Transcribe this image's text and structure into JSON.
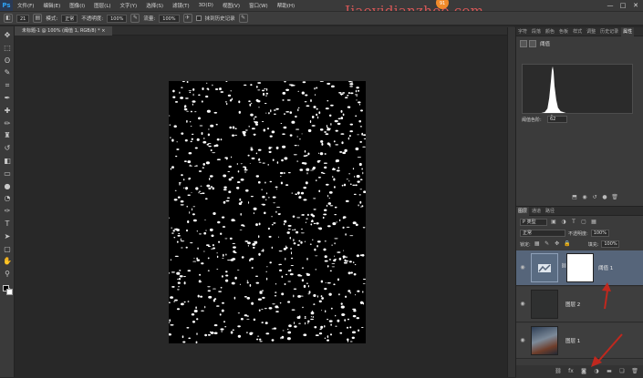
{
  "app": {
    "logo": "Ps"
  },
  "menu": {
    "items": [
      "文件(F)",
      "编辑(E)",
      "图像(I)",
      "图层(L)",
      "文字(Y)",
      "选择(S)",
      "滤镜(T)",
      "3D(D)",
      "视图(V)",
      "窗口(W)",
      "帮助(H)"
    ]
  },
  "watermark": {
    "text": "Jiaoyidianzhoo.com"
  },
  "badge": {
    "text": "91"
  },
  "window_controls": {
    "minimize": "—",
    "maximize": "□",
    "close": "✕"
  },
  "options": {
    "brush_size": "21",
    "mode_label": "模式:",
    "mode_value": "正常",
    "opacity_label": "不透明度:",
    "opacity_value": "100%",
    "flow_label": "流量:",
    "flow_value": "100%",
    "history_label": "抹到历史记录"
  },
  "document": {
    "tab_title": "未标题-1 @ 100% (阈值 1, RGB/8) *",
    "tab_close": "×"
  },
  "tools": [
    {
      "name": "move-tool-icon",
      "glyph": "✥"
    },
    {
      "name": "marquee-tool-icon",
      "glyph": "⬚"
    },
    {
      "name": "lasso-tool-icon",
      "glyph": "ʘ"
    },
    {
      "name": "quick-select-tool-icon",
      "glyph": "✎"
    },
    {
      "name": "crop-tool-icon",
      "glyph": "⌗"
    },
    {
      "name": "eyedropper-tool-icon",
      "glyph": "✒"
    },
    {
      "name": "healing-brush-tool-icon",
      "glyph": "✚"
    },
    {
      "name": "brush-tool-icon",
      "glyph": "✏"
    },
    {
      "name": "stamp-tool-icon",
      "glyph": "♜"
    },
    {
      "name": "history-brush-tool-icon",
      "glyph": "↺"
    },
    {
      "name": "eraser-tool-icon",
      "glyph": "◧"
    },
    {
      "name": "gradient-tool-icon",
      "glyph": "▭"
    },
    {
      "name": "blur-tool-icon",
      "glyph": "●"
    },
    {
      "name": "dodge-tool-icon",
      "glyph": "◔"
    },
    {
      "name": "pen-tool-icon",
      "glyph": "✑"
    },
    {
      "name": "type-tool-icon",
      "glyph": "T"
    },
    {
      "name": "path-select-tool-icon",
      "glyph": "➤"
    },
    {
      "name": "shape-tool-icon",
      "glyph": "▢"
    },
    {
      "name": "hand-tool-icon",
      "glyph": "✋"
    },
    {
      "name": "zoom-tool-icon",
      "glyph": "⚲"
    },
    {
      "name": "more-tools-icon",
      "glyph": "…"
    }
  ],
  "properties_panel": {
    "tabs": [
      "字符",
      "段落",
      "颜色",
      "色板",
      "样式",
      "调整",
      "历史记录",
      "属性"
    ],
    "active_tab": "属性",
    "adjustment_name": "阈值",
    "threshold_label": "阈值色阶:",
    "threshold_value": "62"
  },
  "layers_panel": {
    "tabs": [
      "图层",
      "通道",
      "路径"
    ],
    "filter": "P 类型",
    "blend_mode": "正常",
    "opacity_label": "不透明度:",
    "opacity_value": "100%",
    "lock_label": "锁定:",
    "fill_label": "填充:",
    "fill_value": "100%",
    "layers": [
      {
        "name": "阈值 1",
        "selected": true
      },
      {
        "name": "图层 2",
        "selected": false
      },
      {
        "name": "图层 1",
        "selected": false
      }
    ],
    "footer_icons": [
      "link-icon",
      "fx-icon",
      "mask-icon",
      "adjustment-icon",
      "folder-icon",
      "new-layer-icon",
      "trash-icon"
    ]
  },
  "colors": {
    "accent": "#56657a",
    "foreground": "#000000",
    "background": "#ffffff",
    "annotation": "#c0281e"
  }
}
